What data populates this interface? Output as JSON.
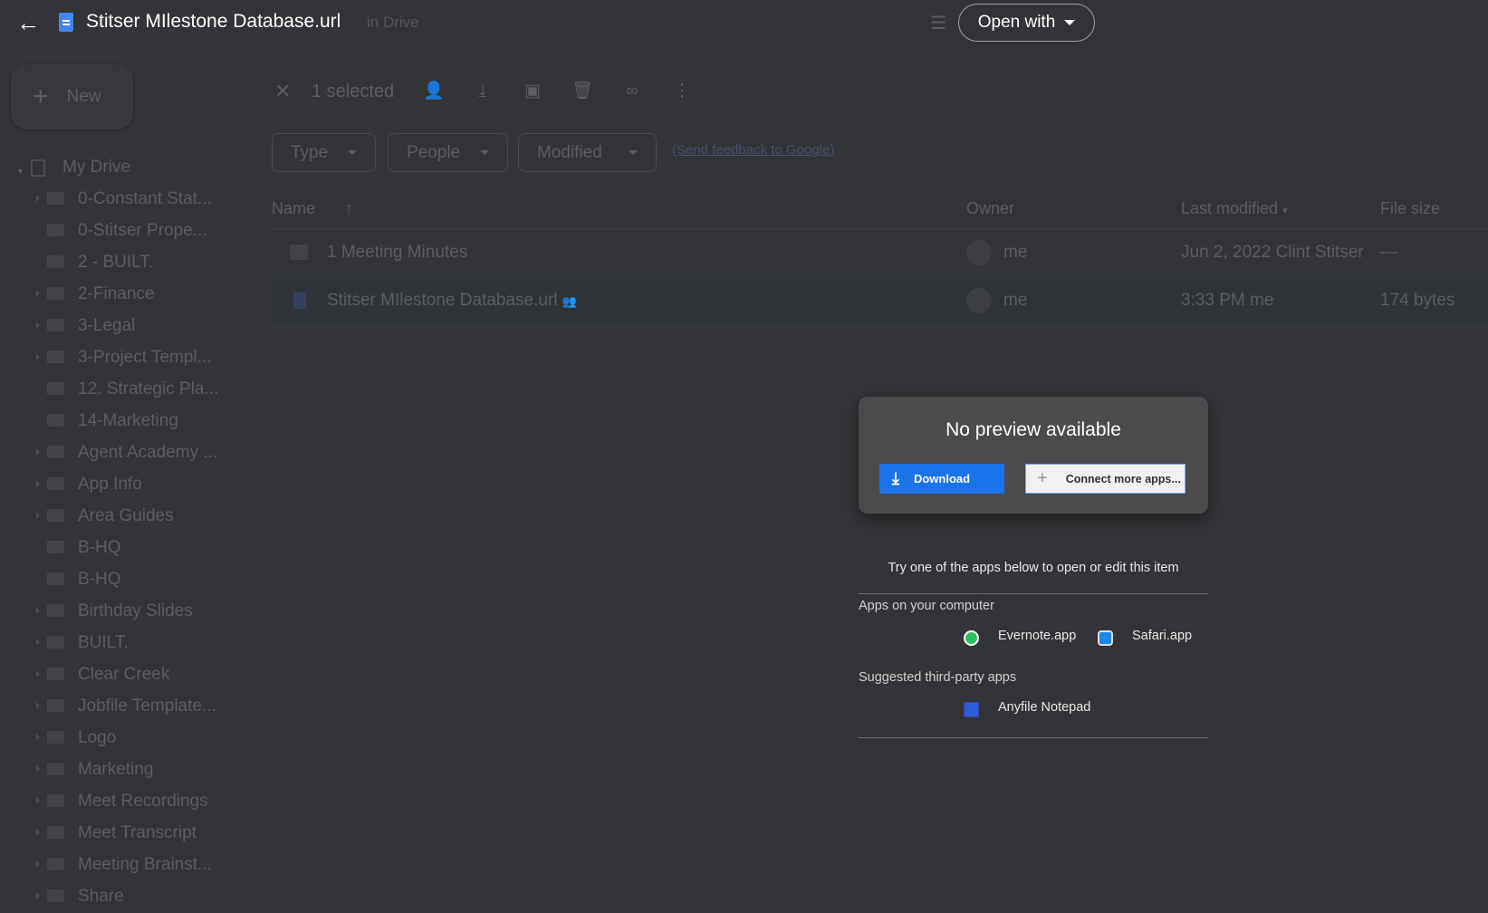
{
  "header": {
    "title": "Stitser MIlestone Database.url",
    "open_with": "Open with",
    "search_hint": "in Drive"
  },
  "sidebar": {
    "new_label": "New",
    "root": "My Drive",
    "items": [
      {
        "label": "0-Constant Stat...",
        "icon": "folder"
      },
      {
        "label": "0-Stitser Prope...",
        "icon": "shortcut-folder"
      },
      {
        "label": "2 - BUILT.",
        "icon": "shortcut-folder"
      },
      {
        "label": "2-Finance",
        "icon": "folder"
      },
      {
        "label": "3-Legal",
        "icon": "folder"
      },
      {
        "label": "3-Project Templ...",
        "icon": "shared-folder"
      },
      {
        "label": "12. Strategic Pla...",
        "icon": "shortcut-folder"
      },
      {
        "label": "14-Marketing",
        "icon": "shortcut-folder"
      },
      {
        "label": "Agent Academy ...",
        "icon": "folder"
      },
      {
        "label": "App Info",
        "icon": "folder"
      },
      {
        "label": "Area Guides",
        "icon": "folder"
      },
      {
        "label": "B-HQ",
        "icon": "shortcut-folder"
      },
      {
        "label": "B-HQ",
        "icon": "shortcut-folder"
      },
      {
        "label": "Birthday Slides",
        "icon": "folder"
      },
      {
        "label": "BUILT.",
        "icon": "folder"
      },
      {
        "label": "Clear Creek",
        "icon": "folder"
      },
      {
        "label": "Jobfile Template...",
        "icon": "shared-folder"
      },
      {
        "label": "Logo",
        "icon": "shared-folder"
      },
      {
        "label": "Marketing",
        "icon": "folder"
      },
      {
        "label": "Meet Recordings",
        "icon": "folder"
      },
      {
        "label": "Meet Transcript",
        "icon": "folder"
      },
      {
        "label": "Meeting Brainst...",
        "icon": "shared-folder"
      },
      {
        "label": "Share",
        "icon": "folder"
      }
    ]
  },
  "toolbar": {
    "selected": "1 selected"
  },
  "filters": {
    "type": "Type",
    "people": "People",
    "modified": "Modified",
    "feedback": "(Send feedback to Google)"
  },
  "columns": {
    "name": "Name",
    "owner": "Owner",
    "modified": "Last modified",
    "size": "File size"
  },
  "rows": [
    {
      "name": "1 Meeting Minutes",
      "owner": "me",
      "modified": "Jun 2, 2022 Clint Stitser",
      "size": "—"
    },
    {
      "name": "Stitser MIlestone Database.url",
      "owner": "me",
      "modified": "3:33 PM me",
      "size": "174 bytes"
    }
  ],
  "preview": {
    "title": "No preview available",
    "download": "Download",
    "connect": "Connect more apps...",
    "hint": "Try one of the apps below to open or edit this item",
    "computer_heading": "Apps on your computer",
    "computer_apps": [
      "Evernote.app",
      "Safari.app"
    ],
    "suggested_heading": "Suggested third-party apps",
    "suggested_apps": [
      "Anyfile Notepad"
    ]
  },
  "colors": {
    "accent": "#1a73e8",
    "background": "#333437"
  }
}
